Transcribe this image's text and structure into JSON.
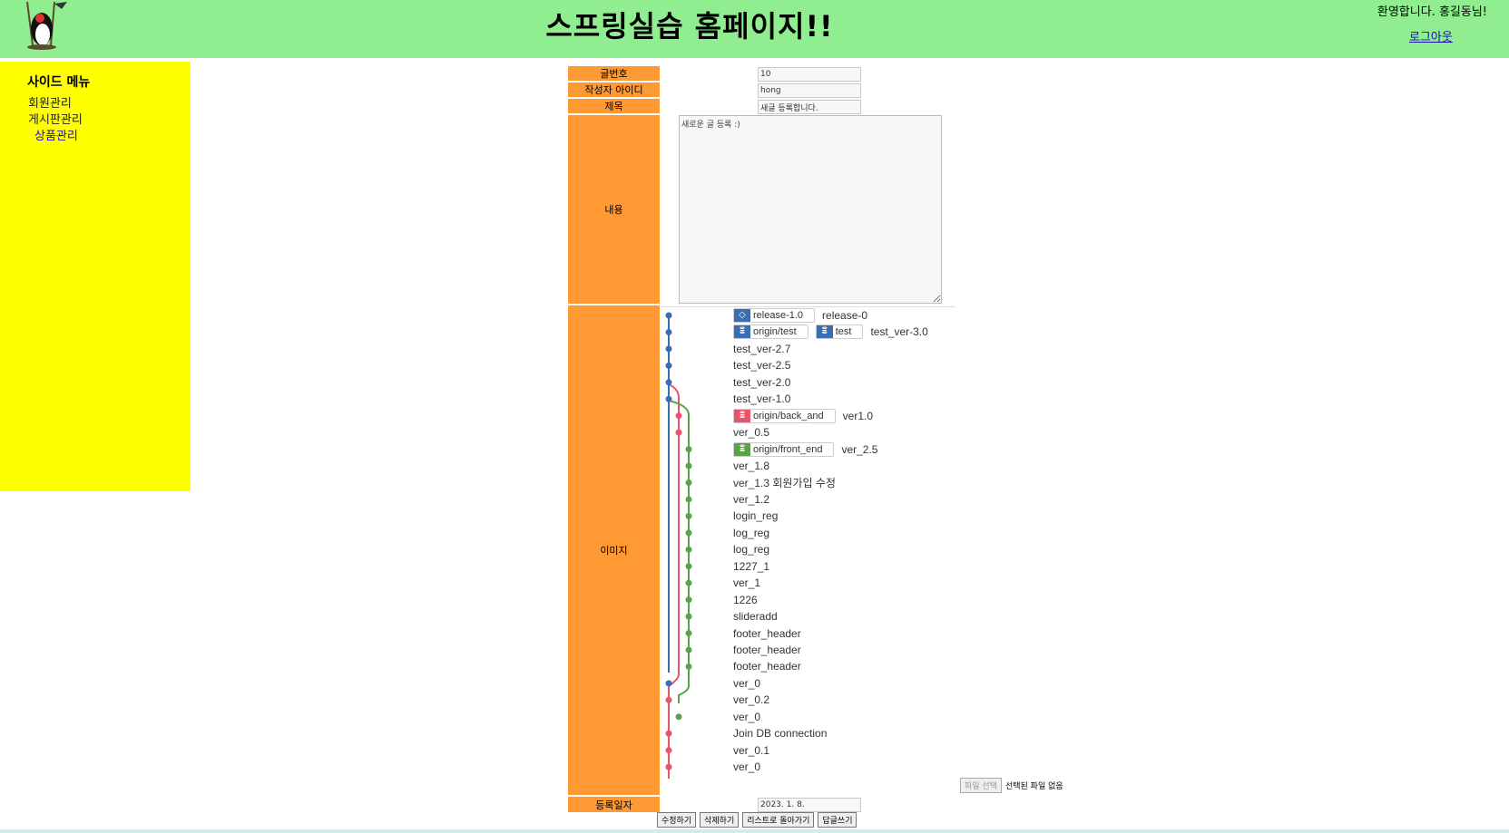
{
  "header": {
    "title": "스프링실습 홈페이지!!",
    "welcome": "환영합니다. 홍길동님!",
    "logout": "로그아웃",
    "logo_icon": "duke-mascot-icon"
  },
  "sidebar": {
    "title": "사이드 메뉴",
    "items": [
      {
        "label": "회원관리"
      },
      {
        "label": "게시판관리"
      },
      {
        "label": "상품관리"
      }
    ]
  },
  "form": {
    "labels": {
      "article_no": "글번호",
      "writer_id": "작성자 아이디",
      "title": "제목",
      "content": "내용",
      "image": "이미지",
      "reg_date": "등록일자"
    },
    "values": {
      "article_no": "10",
      "writer_id": "hong",
      "title": "새글 등록합니다.",
      "content": "새로운 글 등록 :)",
      "reg_date": "2023. 1. 8."
    },
    "file": {
      "button": "파일 선택",
      "status": "선택된 파일 없음"
    }
  },
  "git_graph": {
    "colors": {
      "blue": "#3b6db3",
      "red": "#e8546b",
      "green": "#5aa34a"
    },
    "commits": [
      {
        "refs": [
          {
            "label": "release-1.0",
            "type": "tag",
            "color": "#3b6db3"
          }
        ],
        "message": "release-0"
      },
      {
        "refs": [
          {
            "label": "origin/test",
            "type": "branch",
            "color": "#3b6db3"
          },
          {
            "label": "test",
            "type": "branch",
            "color": "#3b6db3"
          }
        ],
        "message": "test_ver-3.0"
      },
      {
        "refs": [],
        "message": "test_ver-2.7"
      },
      {
        "refs": [],
        "message": "test_ver-2.5"
      },
      {
        "refs": [],
        "message": "test_ver-2.0"
      },
      {
        "refs": [],
        "message": "test_ver-1.0"
      },
      {
        "refs": [
          {
            "label": "origin/back_and",
            "type": "branch",
            "color": "#e8546b"
          }
        ],
        "message": "ver1.0"
      },
      {
        "refs": [],
        "message": "ver_0.5"
      },
      {
        "refs": [
          {
            "label": "origin/front_end",
            "type": "branch",
            "color": "#5aa34a"
          }
        ],
        "message": "ver_2.5"
      },
      {
        "refs": [],
        "message": "ver_1.8"
      },
      {
        "refs": [],
        "message": " ver_1.3  회원가입 수정"
      },
      {
        "refs": [],
        "message": "ver_1.2"
      },
      {
        "refs": [],
        "message": "login_reg"
      },
      {
        "refs": [],
        "message": "log_reg"
      },
      {
        "refs": [],
        "message": "log_reg"
      },
      {
        "refs": [],
        "message": "1227_1"
      },
      {
        "refs": [],
        "message": "ver_1"
      },
      {
        "refs": [],
        "message": "1226"
      },
      {
        "refs": [],
        "message": "slideradd"
      },
      {
        "refs": [],
        "message": "footer_header"
      },
      {
        "refs": [],
        "message": "footer_header"
      },
      {
        "refs": [],
        "message": "footer_header"
      },
      {
        "refs": [],
        "message": "ver_0"
      },
      {
        "refs": [],
        "message": "ver_0.2"
      },
      {
        "refs": [],
        "message": "ver_0"
      },
      {
        "refs": [],
        "message": "Join DB connection"
      },
      {
        "refs": [],
        "message": "ver_0.1"
      },
      {
        "refs": [],
        "message": "ver_0"
      }
    ]
  },
  "buttons": {
    "edit": "수정하기",
    "delete": "삭제하기",
    "back_to_list": "리스트로 돌아가기",
    "reply": "답글쓰기"
  }
}
